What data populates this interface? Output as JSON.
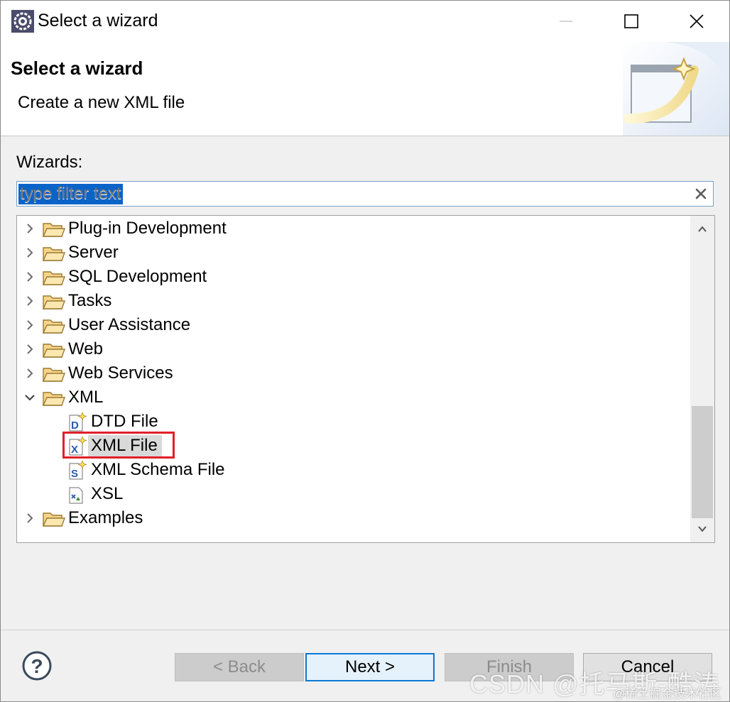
{
  "window": {
    "title": "Select a wizard",
    "controls": {
      "minimize": "minimize-icon",
      "maximize": "maximize-icon",
      "close": "close-icon"
    }
  },
  "header": {
    "title": "Select a wizard",
    "subtitle": "Create a new XML file"
  },
  "filter": {
    "label": "Wizards:",
    "value": "type filter text",
    "placeholder": "type filter text"
  },
  "tree": {
    "items": [
      {
        "label": "Plug-in Development",
        "type": "folder",
        "expanded": false
      },
      {
        "label": "Server",
        "type": "folder",
        "expanded": false
      },
      {
        "label": "SQL Development",
        "type": "folder",
        "expanded": false
      },
      {
        "label": "Tasks",
        "type": "folder",
        "expanded": false
      },
      {
        "label": "User Assistance",
        "type": "folder",
        "expanded": false
      },
      {
        "label": "Web",
        "type": "folder",
        "expanded": false
      },
      {
        "label": "Web Services",
        "type": "folder",
        "expanded": false
      },
      {
        "label": "XML",
        "type": "folder",
        "expanded": true,
        "children": [
          {
            "label": "DTD File",
            "icon": "dtd-file-icon"
          },
          {
            "label": "XML File",
            "icon": "xml-file-icon",
            "selected": true
          },
          {
            "label": "XML Schema File",
            "icon": "xml-schema-file-icon"
          },
          {
            "label": "XSL",
            "icon": "xsl-file-icon"
          }
        ]
      },
      {
        "label": "Examples",
        "type": "folder",
        "expanded": false
      }
    ]
  },
  "buttons": {
    "back": "< Back",
    "next": "Next >",
    "finish": "Finish",
    "cancel": "Cancel"
  },
  "watermark": {
    "main": "CSDN @托马斯-酷涛",
    "sub": "@稀土掘金技术社区"
  },
  "colors": {
    "selection": "#0a64c8",
    "highlight_box": "#e0202a",
    "default_button_border": "#0a78d7"
  }
}
